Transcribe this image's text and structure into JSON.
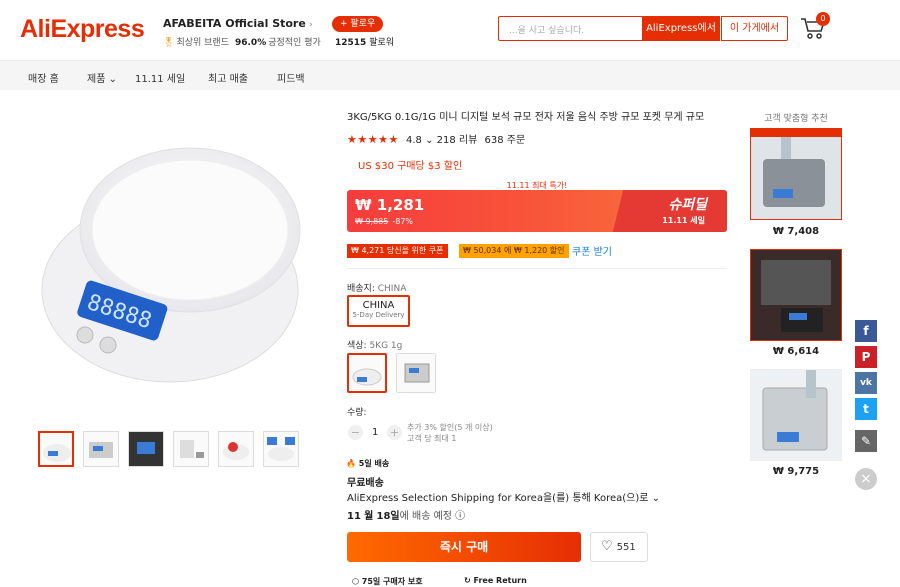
{
  "header": {
    "logo": "AliExpress",
    "store_name": "AFABEITA Official Store",
    "store_badge": "최상위 브랜드",
    "positive_rate": "96.0%",
    "positive_label": "긍정적인 평가",
    "follow_label": "+ 팔로우",
    "followers_count": "12515",
    "followers_label": "팔로워",
    "search_placeholder": "...을 사고 싶습니다.",
    "search_aliexpress": "AliExpress에서",
    "search_store": "이 가게에서",
    "cart_count": "0"
  },
  "nav": [
    "매장 홈",
    "제품",
    "11.11 세일",
    "최고 매출",
    "피드백"
  ],
  "product": {
    "title": "3KG/5KG 0.1G/1G 미니 디지털 보석 규모 전자 저울 음식 주방 규모 포켓 무게 규모",
    "rating": "4.8",
    "reviews": "218 리뷰",
    "orders": "638 주문",
    "coupon_offer": "US $30 구매당 $3 할인",
    "flash_label": "11.11 최대 특가!",
    "price": "₩ 1,281",
    "original_price": "₩ 9,885",
    "discount": "-87%",
    "super_deal": "슈퍼딜",
    "super_sale": "11.11 세일",
    "coupon_1": "₩ 4,271 당신을 위한 쿠폰",
    "coupon_2": "₩ 50,034 에 ₩ 1,220 할인",
    "coupon_link": "쿠폰 받기",
    "ship_from_label": "배송지:",
    "ship_from_value": "CHINA",
    "country": "CHINA",
    "country_sub": "5-Day Delivery",
    "color_label": "색상:",
    "color_value": "5KG 1g",
    "qty_label": "수량:",
    "qty_value": "1",
    "qty_note_1": "추가 3% 할인(5 개 이상)",
    "qty_note_2": "고객 당 최대 1",
    "fast_delivery": "5일 배송",
    "free_shipping": "무료배송",
    "shipping_desc": "AliExpress Selection Shipping for Korea을(를) 통해 Korea(으)로",
    "delivery_month": "11",
    "delivery_month_unit": "월",
    "delivery_day": "18일",
    "delivery_suffix": "에 배송 예정",
    "buy_now": "즉시 구매",
    "wishlist_count": "551",
    "guarantee_1": "75일 구매자 보호",
    "guarantee_2": "Free Return"
  },
  "recommend": {
    "title": "고객 맞춤형 추천",
    "items": [
      {
        "price": "₩ 7,408"
      },
      {
        "price": "₩ 6,614"
      },
      {
        "price": "₩ 9,775"
      }
    ]
  },
  "colors": {
    "brand": "#e62e04",
    "facebook": "#3b5998",
    "pinterest": "#cb2027",
    "vk": "#4c75a3",
    "twitter": "#1da1f2",
    "edit": "#666666"
  }
}
